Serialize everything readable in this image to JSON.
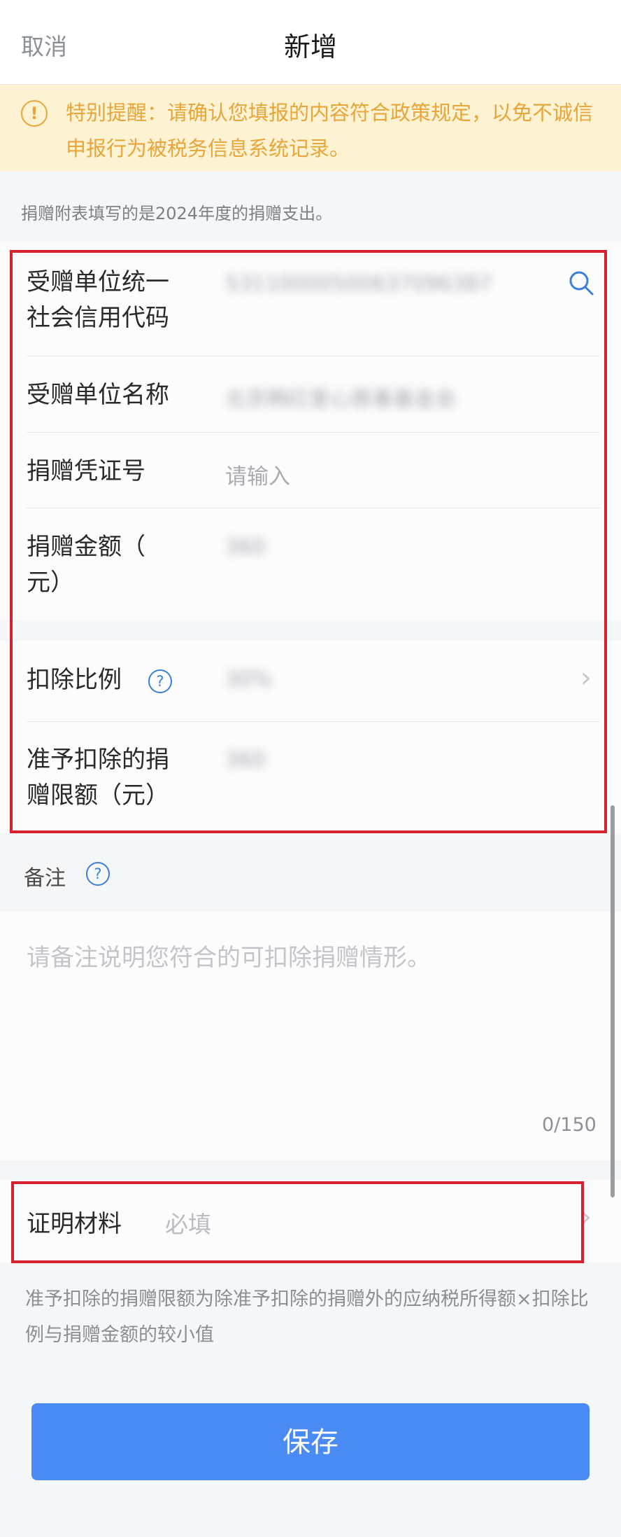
{
  "header": {
    "cancel": "取消",
    "title": "新增"
  },
  "notice": {
    "text": "特别提醒：请确认您填报的内容符合政策规定，以免不诚信申报行为被税务信息系统记录。"
  },
  "info": "捐赠附表填写的是2024年度的捐赠支出。",
  "form": {
    "credit_code": {
      "label_line1": "受赠单位统一",
      "label_line2": "社会信用代码",
      "value": "53110000500637096387"
    },
    "org_name": {
      "label": "受赠单位名称",
      "value": "北京韩红爱心慈善基金会"
    },
    "voucher": {
      "label": "捐赠凭证号",
      "placeholder": "请输入"
    },
    "amount": {
      "label_line1": "捐赠金额（",
      "label_line2": "元）",
      "value": "360"
    },
    "ratio": {
      "label": "扣除比例",
      "value": "30%"
    },
    "limit": {
      "label_line1": "准予扣除的捐",
      "label_line2": "赠限额（元）",
      "value": "360"
    }
  },
  "remark": {
    "label": "备注",
    "placeholder": "请备注说明您符合的可扣除捐赠情形。",
    "counter": "0/150"
  },
  "proof": {
    "label": "证明材料",
    "placeholder": "必填"
  },
  "footnote": "准予扣除的捐赠限额为除准予扣除的捐赠外的应纳税所得额×扣除比例与捐赠金额的较小值",
  "save": "保存",
  "icons": {
    "notice": "exclamation-circle-icon",
    "search": "search-icon",
    "help": "question-circle-icon",
    "chevron": "chevron-right-icon"
  },
  "colors": {
    "accent": "#4a8af3",
    "warning": "#e8a53a",
    "highlight": "#d8212f"
  }
}
